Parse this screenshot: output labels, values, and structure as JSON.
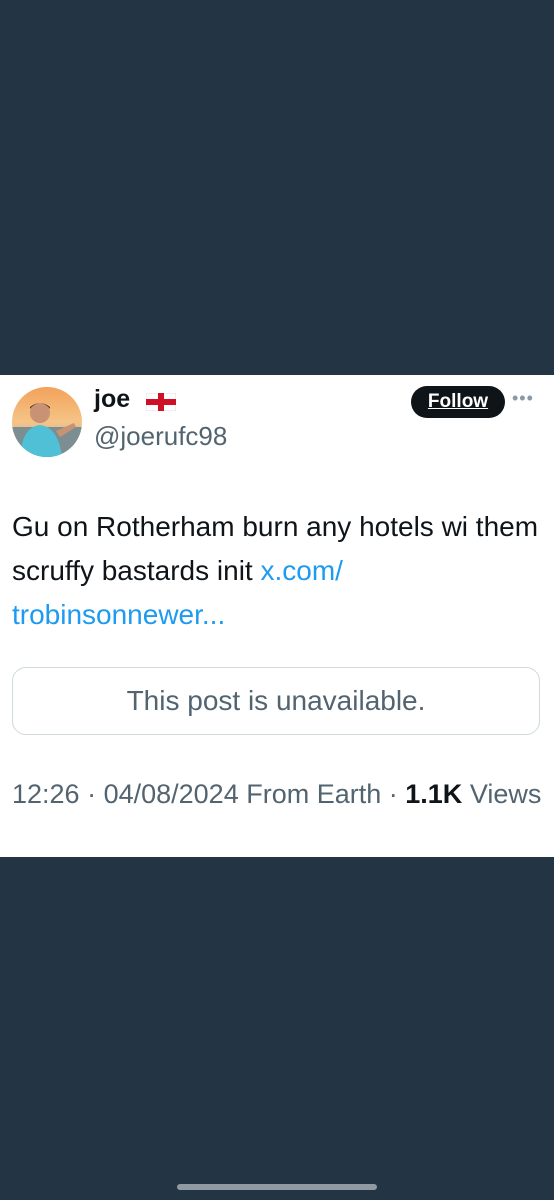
{
  "post": {
    "display_name": "joe",
    "flag_icon": "england-flag-icon",
    "handle": "@joerufc98",
    "follow_label": "Follow",
    "more_icon": "more-options-icon",
    "text": "Gu on Rotherham burn any hotels wi them scruffy bastards init ",
    "link_text": "x.com/​trobinsonnewer...",
    "quoted_unavailable": "This post is unavailable.",
    "time": "12:26",
    "date": "04/08/2024",
    "source": "From Earth",
    "views_count": "1.1K",
    "views_label": "Views"
  },
  "colors": {
    "background": "#233544",
    "card": "#ffffff",
    "link": "#1d9bf0",
    "text_primary": "#0f1419",
    "text_secondary": "#536471"
  }
}
